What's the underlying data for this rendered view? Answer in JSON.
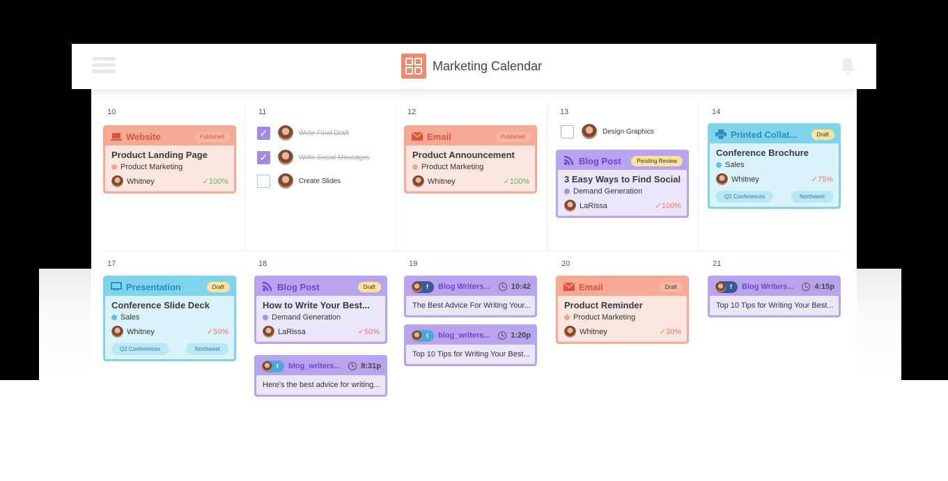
{
  "header": {
    "title": "Marketing Calendar",
    "menu_icon": "hamburger-menu-icon",
    "logo_icon": "calendar-grid-icon",
    "notification_icon": "bell-icon"
  },
  "colors": {
    "orange": "#f6a994",
    "purple": "#b8a4ee",
    "blue": "#7fd4ec",
    "draft_badge": "#fde29b",
    "logo": "#f08a6c",
    "success_green": "#5cb85c",
    "progress_orange": "#f07a55"
  },
  "weeks": [
    {
      "days": [
        {
          "num": "10"
        },
        {
          "num": "11"
        },
        {
          "num": "12"
        },
        {
          "num": "13"
        },
        {
          "num": "14"
        }
      ]
    },
    {
      "days": [
        {
          "num": "17"
        },
        {
          "num": "18"
        },
        {
          "num": "19"
        },
        {
          "num": "20"
        },
        {
          "num": "21"
        }
      ]
    }
  ],
  "cards": {
    "website": {
      "type": "Website",
      "icon": "laptop-icon",
      "status": "Published",
      "title": "Product Landing Page",
      "category": "Product Marketing",
      "owner": "Whitney",
      "progress": "100%"
    },
    "email1": {
      "type": "Email",
      "icon": "envelope-icon",
      "status": "Published",
      "title": "Product Announcement",
      "category": "Product Marketing",
      "owner": "Whitney",
      "progress": "100%"
    },
    "blog1": {
      "type": "Blog Post",
      "icon": "rss-icon",
      "status": "Pending Review",
      "title": "3 Easy Ways to Find Social...",
      "category": "Demand Generation",
      "owner": "LaRissa",
      "progress": "100%"
    },
    "printed": {
      "type": "Printed Collat...",
      "icon": "printer-icon",
      "status": "Draft",
      "title": "Conference Brochure",
      "category": "Sales",
      "owner": "Whitney",
      "progress": "75%",
      "tags": [
        "Q2 Conferences",
        "Northwest"
      ]
    },
    "presentation": {
      "type": "Presentation",
      "icon": "presentation-icon",
      "status": "Draft",
      "title": "Conference Slide Deck",
      "category": "Sales",
      "owner": "Whitney",
      "progress": "50%",
      "tags": [
        "Q2 Conferences",
        "Northwest"
      ]
    },
    "blog2": {
      "type": "Blog Post",
      "icon": "rss-icon",
      "status": "Draft",
      "title": "How to Write Your Best...",
      "category": "Demand Generation",
      "owner": "LaRissa",
      "progress": "50%"
    },
    "email2": {
      "type": "Email",
      "icon": "envelope-icon",
      "status": "Draft",
      "title": "Product Reminder",
      "category": "Product Marketing",
      "owner": "Whitney",
      "progress": "30%"
    }
  },
  "social": {
    "tw18": {
      "network": "twitter",
      "account": "blog_writers...",
      "time": "8:31p",
      "text": "Here's the best advice for writing..."
    },
    "fb19": {
      "network": "facebook",
      "account": "Blog Writers...",
      "time": "10:42",
      "text": "The Best Advice For Writing Your..."
    },
    "tw19": {
      "network": "twitter",
      "account": "blog_writers...",
      "time": "1:20p",
      "text": "Top 10 Tips for Writing Your Best..."
    },
    "fb21": {
      "network": "facebook",
      "account": "Blog Writers...",
      "time": "4:15p",
      "text": "Top 10 Tips for Writing Your Best..."
    }
  },
  "tasks": {
    "day11": [
      {
        "label": "Write Final Draft",
        "checked": true
      },
      {
        "label": "Write Social Messages",
        "checked": true
      },
      {
        "label": "Create Slides",
        "checked": false
      }
    ],
    "day13": [
      {
        "label": "Design Graphics",
        "checked": false
      }
    ]
  }
}
